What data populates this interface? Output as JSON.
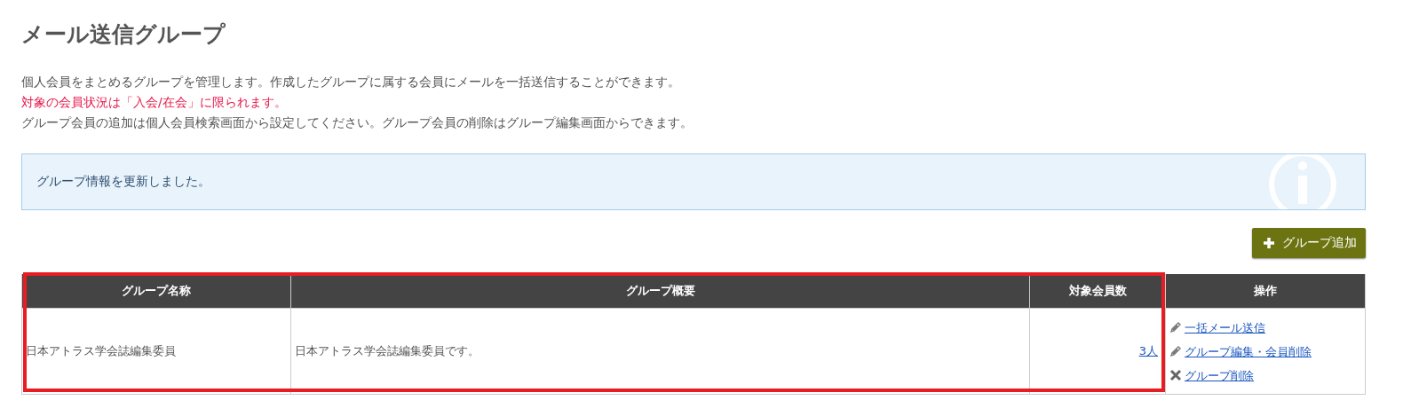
{
  "title": "メール送信グループ",
  "notes": [
    {
      "text": "個人会員をまとめるグループを管理します。作成したグループに属する会員にメールを一括送信することができます。",
      "kind": "normal"
    },
    {
      "text": "対象の会員状況は「入会/在会」に限られます。",
      "kind": "warning"
    },
    {
      "text": "グループ会員の追加は個人会員検索画面から設定してください。グループ会員の削除はグループ編集画面からできます。",
      "kind": "normal"
    }
  ],
  "alert": {
    "text": "グループ情報を更新しました。"
  },
  "add_button": {
    "label": "グループ追加"
  },
  "table": {
    "columns": [
      "グループ名称",
      "グループ概要",
      "対象会員数",
      "操作"
    ],
    "rows": [
      {
        "name": "日本アトラス学会誌編集委員",
        "summary": "日本アトラス学会誌編集委員です。",
        "members": "3人",
        "actions": [
          {
            "label": "一括メール送信",
            "kind": "edit"
          },
          {
            "label": "グループ編集・会員削除",
            "kind": "edit"
          },
          {
            "label": "グループ削除",
            "kind": "delete"
          }
        ]
      }
    ]
  }
}
